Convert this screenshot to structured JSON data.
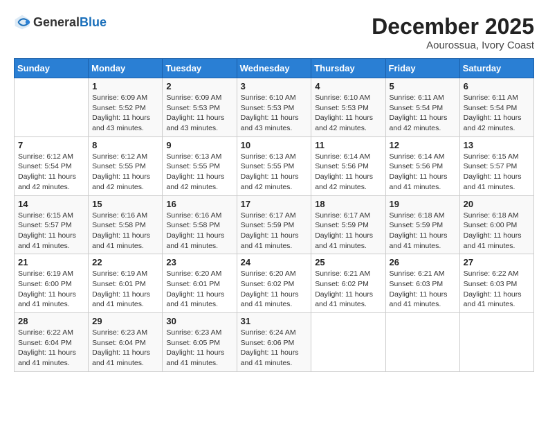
{
  "header": {
    "logo_general": "General",
    "logo_blue": "Blue",
    "month_year": "December 2025",
    "location": "Aourossua, Ivory Coast"
  },
  "calendar": {
    "days_of_week": [
      "Sunday",
      "Monday",
      "Tuesday",
      "Wednesday",
      "Thursday",
      "Friday",
      "Saturday"
    ],
    "weeks": [
      [
        {
          "day": "",
          "info": ""
        },
        {
          "day": "1",
          "info": "Sunrise: 6:09 AM\nSunset: 5:52 PM\nDaylight: 11 hours and 43 minutes."
        },
        {
          "day": "2",
          "info": "Sunrise: 6:09 AM\nSunset: 5:53 PM\nDaylight: 11 hours and 43 minutes."
        },
        {
          "day": "3",
          "info": "Sunrise: 6:10 AM\nSunset: 5:53 PM\nDaylight: 11 hours and 43 minutes."
        },
        {
          "day": "4",
          "info": "Sunrise: 6:10 AM\nSunset: 5:53 PM\nDaylight: 11 hours and 42 minutes."
        },
        {
          "day": "5",
          "info": "Sunrise: 6:11 AM\nSunset: 5:54 PM\nDaylight: 11 hours and 42 minutes."
        },
        {
          "day": "6",
          "info": "Sunrise: 6:11 AM\nSunset: 5:54 PM\nDaylight: 11 hours and 42 minutes."
        }
      ],
      [
        {
          "day": "7",
          "info": "Sunrise: 6:12 AM\nSunset: 5:54 PM\nDaylight: 11 hours and 42 minutes."
        },
        {
          "day": "8",
          "info": "Sunrise: 6:12 AM\nSunset: 5:55 PM\nDaylight: 11 hours and 42 minutes."
        },
        {
          "day": "9",
          "info": "Sunrise: 6:13 AM\nSunset: 5:55 PM\nDaylight: 11 hours and 42 minutes."
        },
        {
          "day": "10",
          "info": "Sunrise: 6:13 AM\nSunset: 5:55 PM\nDaylight: 11 hours and 42 minutes."
        },
        {
          "day": "11",
          "info": "Sunrise: 6:14 AM\nSunset: 5:56 PM\nDaylight: 11 hours and 42 minutes."
        },
        {
          "day": "12",
          "info": "Sunrise: 6:14 AM\nSunset: 5:56 PM\nDaylight: 11 hours and 41 minutes."
        },
        {
          "day": "13",
          "info": "Sunrise: 6:15 AM\nSunset: 5:57 PM\nDaylight: 11 hours and 41 minutes."
        }
      ],
      [
        {
          "day": "14",
          "info": "Sunrise: 6:15 AM\nSunset: 5:57 PM\nDaylight: 11 hours and 41 minutes."
        },
        {
          "day": "15",
          "info": "Sunrise: 6:16 AM\nSunset: 5:58 PM\nDaylight: 11 hours and 41 minutes."
        },
        {
          "day": "16",
          "info": "Sunrise: 6:16 AM\nSunset: 5:58 PM\nDaylight: 11 hours and 41 minutes."
        },
        {
          "day": "17",
          "info": "Sunrise: 6:17 AM\nSunset: 5:59 PM\nDaylight: 11 hours and 41 minutes."
        },
        {
          "day": "18",
          "info": "Sunrise: 6:17 AM\nSunset: 5:59 PM\nDaylight: 11 hours and 41 minutes."
        },
        {
          "day": "19",
          "info": "Sunrise: 6:18 AM\nSunset: 5:59 PM\nDaylight: 11 hours and 41 minutes."
        },
        {
          "day": "20",
          "info": "Sunrise: 6:18 AM\nSunset: 6:00 PM\nDaylight: 11 hours and 41 minutes."
        }
      ],
      [
        {
          "day": "21",
          "info": "Sunrise: 6:19 AM\nSunset: 6:00 PM\nDaylight: 11 hours and 41 minutes."
        },
        {
          "day": "22",
          "info": "Sunrise: 6:19 AM\nSunset: 6:01 PM\nDaylight: 11 hours and 41 minutes."
        },
        {
          "day": "23",
          "info": "Sunrise: 6:20 AM\nSunset: 6:01 PM\nDaylight: 11 hours and 41 minutes."
        },
        {
          "day": "24",
          "info": "Sunrise: 6:20 AM\nSunset: 6:02 PM\nDaylight: 11 hours and 41 minutes."
        },
        {
          "day": "25",
          "info": "Sunrise: 6:21 AM\nSunset: 6:02 PM\nDaylight: 11 hours and 41 minutes."
        },
        {
          "day": "26",
          "info": "Sunrise: 6:21 AM\nSunset: 6:03 PM\nDaylight: 11 hours and 41 minutes."
        },
        {
          "day": "27",
          "info": "Sunrise: 6:22 AM\nSunset: 6:03 PM\nDaylight: 11 hours and 41 minutes."
        }
      ],
      [
        {
          "day": "28",
          "info": "Sunrise: 6:22 AM\nSunset: 6:04 PM\nDaylight: 11 hours and 41 minutes."
        },
        {
          "day": "29",
          "info": "Sunrise: 6:23 AM\nSunset: 6:04 PM\nDaylight: 11 hours and 41 minutes."
        },
        {
          "day": "30",
          "info": "Sunrise: 6:23 AM\nSunset: 6:05 PM\nDaylight: 11 hours and 41 minutes."
        },
        {
          "day": "31",
          "info": "Sunrise: 6:24 AM\nSunset: 6:06 PM\nDaylight: 11 hours and 41 minutes."
        },
        {
          "day": "",
          "info": ""
        },
        {
          "day": "",
          "info": ""
        },
        {
          "day": "",
          "info": ""
        }
      ]
    ]
  }
}
